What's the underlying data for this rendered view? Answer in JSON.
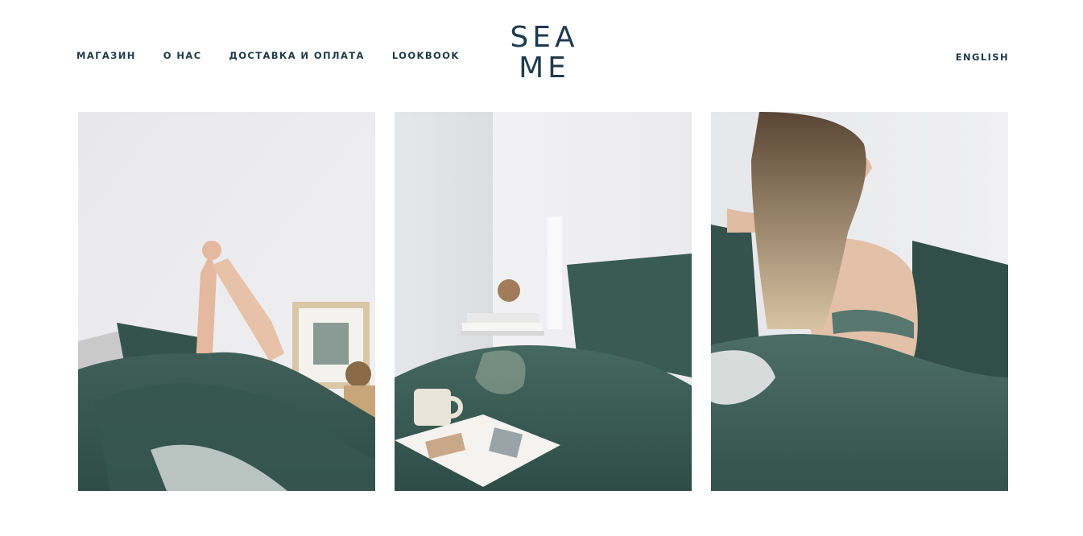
{
  "header": {
    "nav_items": [
      "МАГАЗИН",
      "О НАС",
      "ДОСТАВКА И ОПЛАТА",
      "LOOKBOOK"
    ],
    "logo_line1": "SEA",
    "logo_line2": "ME",
    "language_link": "ENGLISH"
  },
  "gallery": {
    "photos": [
      {
        "subject": "arms-raised-in-bed-photo"
      },
      {
        "subject": "bed-with-coffee-and-magazine-photo"
      },
      {
        "subject": "woman-sitting-in-bed-photo"
      }
    ]
  },
  "colors": {
    "brand_navy": "#1f3a4d",
    "linen_green": "#3d5f58",
    "wall_white": "#eceef0"
  }
}
